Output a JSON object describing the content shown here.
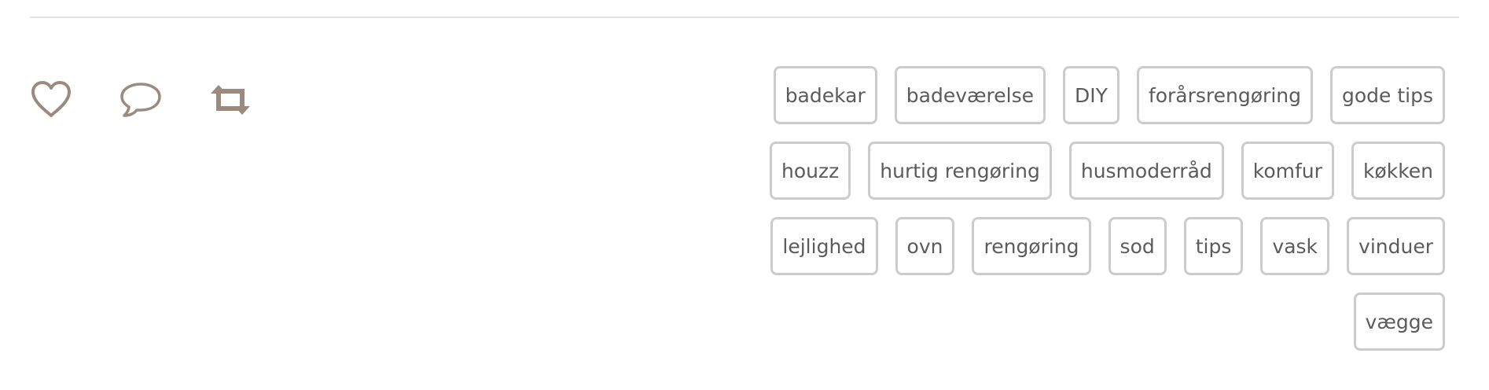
{
  "colors": {
    "icon": "#9a8b7e",
    "tag_border": "#cccccc",
    "tag_text": "#5b5b5b",
    "divider": "#e4e4e4"
  },
  "actions": [
    {
      "name": "like",
      "icon": "heart-icon"
    },
    {
      "name": "comment",
      "icon": "speech-bubble-icon"
    },
    {
      "name": "reblog",
      "icon": "reblog-arrows-icon"
    }
  ],
  "tags": [
    "badekar",
    "badeværelse",
    "DIY",
    "forårsrengøring",
    "gode tips",
    "houzz",
    "hurtig rengøring",
    "husmoderråd",
    "komfur",
    "køkken",
    "lejlighed",
    "ovn",
    "rengøring",
    "sod",
    "tips",
    "vask",
    "vinduer",
    "vægge"
  ]
}
